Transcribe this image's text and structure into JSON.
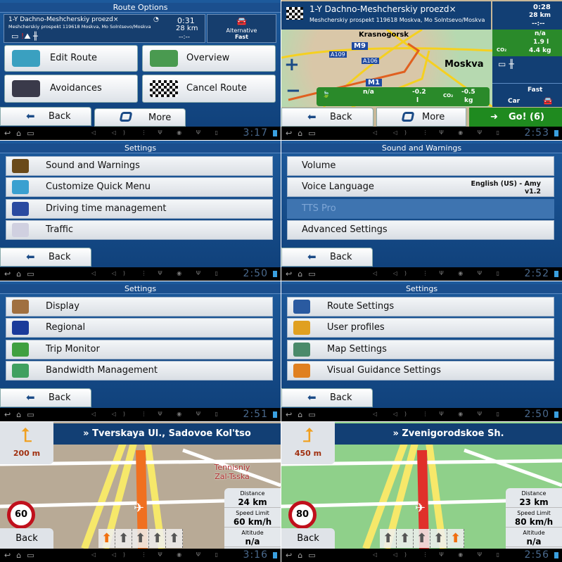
{
  "route_options": {
    "title": "Route Options",
    "dest_line1": "1-Y Dachno-Meshcherskiy proezd×",
    "dest_line2": "Meshcherskiy prospekt 119618 Moskva, Mo Solntsevo/Moskva",
    "time": "0:31",
    "distance": "28 km",
    "eta": "--:--",
    "alt_label": "Alternative",
    "alt_value": "Fast",
    "buttons": [
      "Edit Route",
      "Overview",
      "Avoidances",
      "Cancel Route"
    ],
    "back": "Back",
    "more": "More",
    "clock": "3:17"
  },
  "overview": {
    "dest_line1": "1-Y Dachno-Meshcherskiy proezd×",
    "dest_line2": "Meshcherskiy prospekt 119618 Moskva, Mo Solntsevo/Moskva",
    "time": "0:28",
    "distance": "28 km",
    "eta": "--:--",
    "cost": "n/a",
    "fuel": "1.9 l",
    "co2": "4.4 kg",
    "co2_label": "CO₂",
    "places": [
      "Krasnogorsk",
      "Moskva"
    ],
    "roads": [
      "M9",
      "A109",
      "A106",
      "M1"
    ],
    "eco": {
      "cost": "n/a",
      "fuel": "-0.2",
      "fuel_unit": "l",
      "co2_label": "CO₂",
      "co2": "-0.5",
      "co2_unit": "kg"
    },
    "method": "Fast",
    "vehicle": "Car",
    "zoom_in": "+",
    "zoom_out": "−",
    "back": "Back",
    "more": "More",
    "go": "Go! (6)",
    "clock": "2:53"
  },
  "menus": [
    {
      "title": "Settings",
      "items": [
        "Sound and Warnings",
        "Customize Quick Menu",
        "Driving time management",
        "Traffic"
      ],
      "icons": [
        "#6a4a1a",
        "#3aa0d0",
        "#2a4aa0",
        "#d0d0e0"
      ],
      "back": "Back",
      "clock": "2:50"
    },
    {
      "title": "Sound and Warnings",
      "items": [
        "Volume",
        "Voice Language",
        "TTS Pro",
        "Advanced Settings"
      ],
      "voice_value": "English (US) - Amy v1.2",
      "back": "Back",
      "clock": "2:52"
    },
    {
      "title": "Settings",
      "items": [
        "Display",
        "Regional",
        "Trip Monitor",
        "Bandwidth Management"
      ],
      "icons": [
        "#a07040",
        "#1a3a9a",
        "#40a040",
        "#40a060"
      ],
      "back": "Back",
      "clock": "2:51"
    },
    {
      "title": "Settings",
      "items": [
        "Route Settings",
        "User profiles",
        "Map Settings",
        "Visual Guidance Settings"
      ],
      "icons": [
        "#2a5aa0",
        "#e0a020",
        "#4a8a6a",
        "#e08020"
      ],
      "back": "Back",
      "clock": "2:50"
    }
  ],
  "nav": [
    {
      "street": "» Tverskaya Ul., Sadovoe Kol'tso",
      "turn_distance": "200 m",
      "speed_sign": "60",
      "poi": "Tennisniy Zal-Tsska",
      "distance_label": "Distance",
      "distance": "24 km",
      "limit_label": "Speed Limit",
      "limit": "60 km/h",
      "alt_label": "Altitude",
      "altitude": "n/a",
      "back": "Back",
      "active_lane": 0,
      "clock": "3:16",
      "map_color": "#b8aa96"
    },
    {
      "street": "» Zvenigorodskoe Sh.",
      "turn_distance": "450 m",
      "speed_sign": "80",
      "distance_label": "Distance",
      "distance": "23 km",
      "limit_label": "Speed Limit",
      "limit": "80 km/h",
      "alt_label": "Altitude",
      "altitude": "n/a",
      "back": "Back",
      "active_lane": 4,
      "clock": "2:56",
      "map_color": "#8fd08a"
    }
  ]
}
